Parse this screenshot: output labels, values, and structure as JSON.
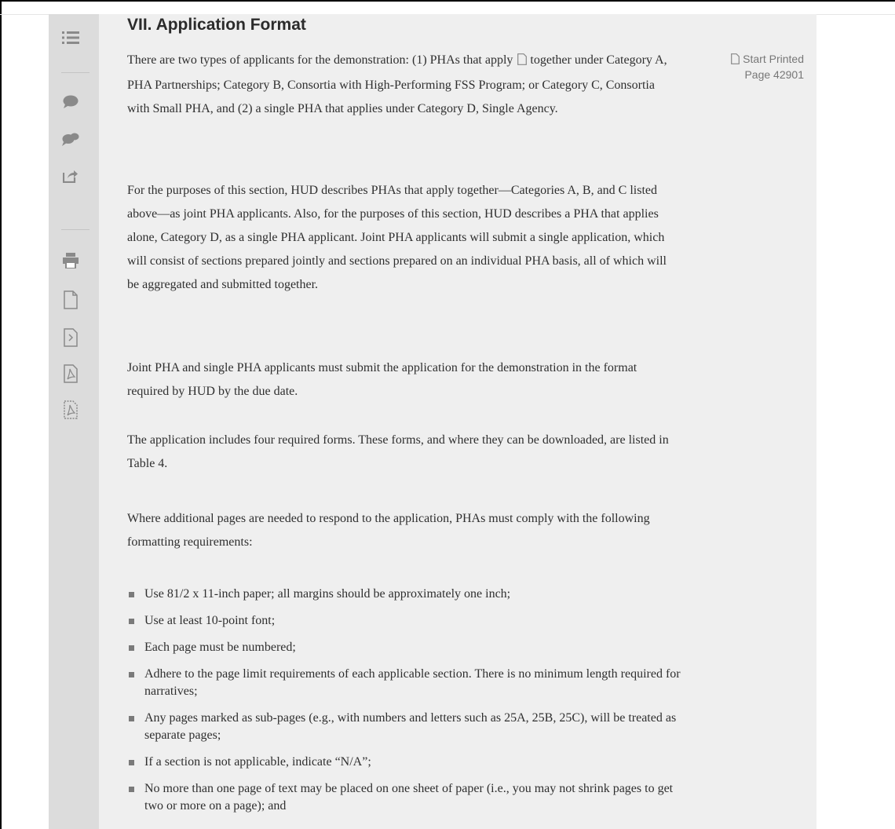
{
  "section": {
    "title": "VII. Application Format"
  },
  "printed_page": {
    "label": "Start Printed",
    "page": "Page 42901"
  },
  "paragraphs": [
    "There are two types of applicants for the demonstration: (1) PHAs that apply together under Category A, PHA Partnerships; Category B, Consortia with High-Performing FSS Program; or Category C, Consortia with Small PHA, and (2) a single PHA that applies under Category D, Single Agency.",
    "For the purposes of this section, HUD describes PHAs that apply together—Categories A, B, and C listed above—as joint PHA applicants. Also, for the purposes of this section, HUD describes a PHA that applies alone, Category D, as a single PHA applicant. Joint PHA applicants will submit a single application, which will consist of sections prepared jointly and sections prepared on an individual PHA basis, all of which will be aggregated and submitted together.",
    "Joint PHA and single PHA applicants must submit the application for the demonstration in the format required by HUD by the due date.",
    "The application includes four required forms. These forms, and where they can be downloaded, are listed in Table 4.",
    "Where additional pages are needed to respond to the application, PHAs must comply with the following formatting requirements:"
  ],
  "para1_lead": "There are two types of applicants for the demonstration: (1) PHAs that apply",
  "para1_rest": "together under Category A, PHA Partnerships; Category B, Consortia with High-Performing FSS Program; or Category C, Consortia with Small PHA, and (2) a single PHA that applies under Category D, Single Agency.",
  "bullets": [
    "Use 81/2 x 11-inch paper; all margins should be approximately one inch;",
    "Use at least 10-point font;",
    "Each page must be numbered;",
    "Adhere to the page limit requirements of each applicable section. There is no minimum length required for narratives;",
    "Any pages marked as sub-pages (e.g., with numbers and letters such as 25A, 25B, 25C), will be treated as separate pages;",
    "If a section is not applicable, indicate “N/A”;",
    "No more than one page of text may be placed on one sheet of paper (i.e., you may not shrink pages to get two or more on a page); and"
  ],
  "icons": {
    "sidebar": [
      "table-of-contents-icon",
      "comment-icon",
      "comments-icon",
      "share-icon",
      "print-icon",
      "document-icon",
      "next-document-icon",
      "pdf-icon",
      "pdf-outline-icon"
    ]
  },
  "colors": {
    "content_bg": "#efefef",
    "sidebar_bg": "#dcdcdc",
    "icon": "#8a8a8a"
  }
}
